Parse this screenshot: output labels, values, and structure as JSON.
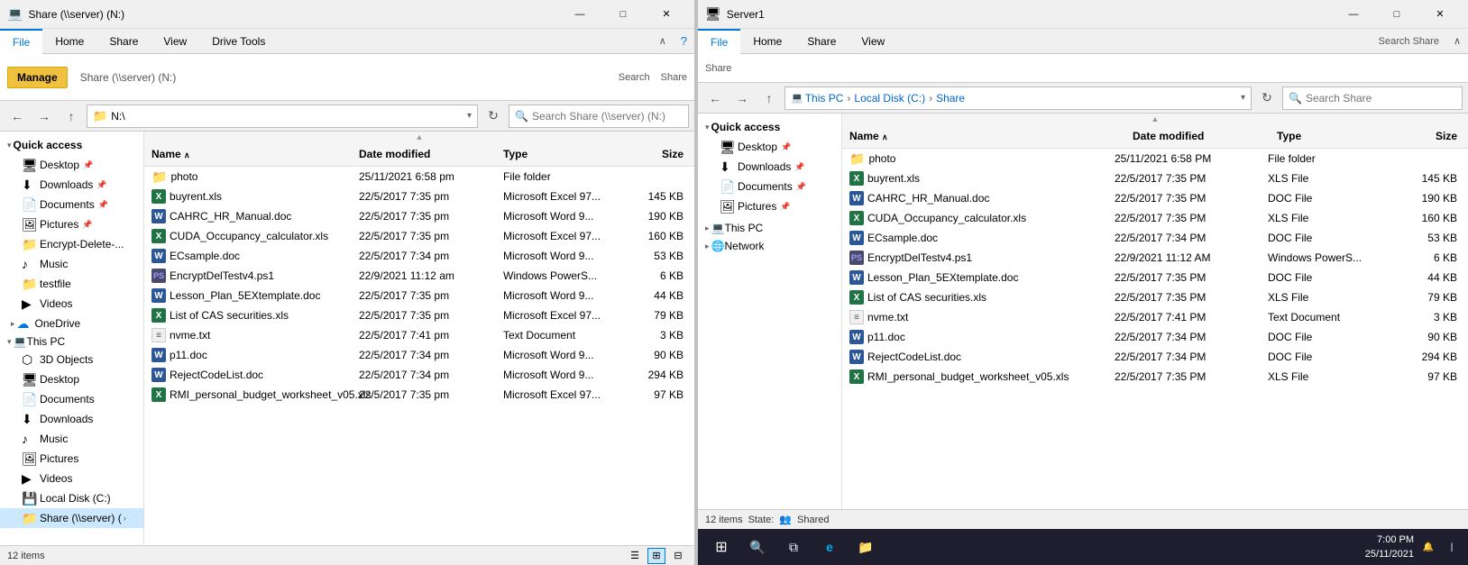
{
  "leftWindow": {
    "title": "Share (\\\\server) (N:)",
    "titlebarLabel": "Share (\\\\server) (N:)",
    "tabs": {
      "file": "File",
      "home": "Home",
      "share": "Share",
      "view": "View",
      "driveTools": "Drive Tools"
    },
    "manageBtn": "Manage",
    "ribbon": {
      "share_label": "Share (\\\\server) (N:)"
    },
    "addressBar": "N:\\",
    "searchPlaceholder": "Search Share (\\\\server) (N:)",
    "columns": {
      "name": "Name",
      "dateModified": "Date modified",
      "type": "Type",
      "size": "Size"
    },
    "files": [
      {
        "name": "photo",
        "date": "25/11/2021 6:58 pm",
        "type": "File folder",
        "size": "",
        "icon": "folder"
      },
      {
        "name": "buyrent.xls",
        "date": "22/5/2017 7:35 pm",
        "type": "Microsoft Excel 97...",
        "size": "145 KB",
        "icon": "excel"
      },
      {
        "name": "CAHRC_HR_Manual.doc",
        "date": "22/5/2017 7:35 pm",
        "type": "Microsoft Word 9...",
        "size": "190 KB",
        "icon": "word"
      },
      {
        "name": "CUDA_Occupancy_calculator.xls",
        "date": "22/5/2017 7:35 pm",
        "type": "Microsoft Excel 97...",
        "size": "160 KB",
        "icon": "excel"
      },
      {
        "name": "ECsample.doc",
        "date": "22/5/2017 7:34 pm",
        "type": "Microsoft Word 9...",
        "size": "53 KB",
        "icon": "word"
      },
      {
        "name": "EncryptDelTestv4.ps1",
        "date": "22/9/2021 11:12 am",
        "type": "Windows PowerS...",
        "size": "6 KB",
        "icon": "ps"
      },
      {
        "name": "Lesson_Plan_5EXtemplate.doc",
        "date": "22/5/2017 7:35 pm",
        "type": "Microsoft Word 9...",
        "size": "44 KB",
        "icon": "word"
      },
      {
        "name": "List of CAS securities.xls",
        "date": "22/5/2017 7:35 pm",
        "type": "Microsoft Excel 97...",
        "size": "79 KB",
        "icon": "excel"
      },
      {
        "name": "nvme.txt",
        "date": "22/5/2017 7:41 pm",
        "type": "Text Document",
        "size": "3 KB",
        "icon": "txt"
      },
      {
        "name": "p11.doc",
        "date": "22/5/2017 7:34 pm",
        "type": "Microsoft Word 9...",
        "size": "90 KB",
        "icon": "word"
      },
      {
        "name": "RejectCodeList.doc",
        "date": "22/5/2017 7:34 pm",
        "type": "Microsoft Word 9...",
        "size": "294 KB",
        "icon": "word"
      },
      {
        "name": "RMI_personal_budget_worksheet_v05.xls",
        "date": "22/5/2017 7:35 pm",
        "type": "Microsoft Excel 97...",
        "size": "97 KB",
        "icon": "excel"
      }
    ],
    "sidebar": {
      "quickAccess": "Quick access",
      "desktop": "Desktop",
      "downloads": "Downloads",
      "documents": "Documents",
      "pictures": "Pictures",
      "encryptDelete": "Encrypt-Delete-...",
      "music": "Music",
      "testfile": "testfile",
      "videos": "Videos",
      "oneDrive": "OneDrive",
      "thisPC": "This PC",
      "objects3d": "3D Objects",
      "desktop2": "Desktop",
      "documents2": "Documents",
      "downloads2": "Downloads",
      "music2": "Music",
      "pictures2": "Pictures",
      "videos2": "Videos",
      "localDisk": "Local Disk (C:)",
      "share": "Share (\\\\server) ("
    },
    "statusBar": {
      "itemCount": "12 items"
    }
  },
  "rightWindow": {
    "title": "Server1",
    "tabs": {
      "file": "File",
      "home": "Home",
      "share": "Share",
      "view": "View"
    },
    "breadcrumb": [
      "This PC",
      "Local Disk (C:)",
      "Share"
    ],
    "searchPlaceholder": "Search Share",
    "columns": {
      "name": "Name",
      "dateModified": "Date modified",
      "type": "Type",
      "size": "Size"
    },
    "sidebar": {
      "quickAccess": "Quick access",
      "desktop": "Desktop",
      "downloads": "Downloads",
      "documents": "Documents",
      "pictures": "Pictures",
      "thisPC": "This PC",
      "network": "Network"
    },
    "files": [
      {
        "name": "photo",
        "date": "25/11/2021 6:58 PM",
        "type": "File folder",
        "size": "",
        "icon": "folder"
      },
      {
        "name": "buyrent.xls",
        "date": "22/5/2017 7:35 PM",
        "type": "XLS File",
        "size": "145 KB",
        "icon": "excel"
      },
      {
        "name": "CAHRC_HR_Manual.doc",
        "date": "22/5/2017 7:35 PM",
        "type": "DOC File",
        "size": "190 KB",
        "icon": "word"
      },
      {
        "name": "CUDA_Occupancy_calculator.xls",
        "date": "22/5/2017 7:35 PM",
        "type": "XLS File",
        "size": "160 KB",
        "icon": "excel"
      },
      {
        "name": "ECsample.doc",
        "date": "22/5/2017 7:34 PM",
        "type": "DOC File",
        "size": "53 KB",
        "icon": "word"
      },
      {
        "name": "EncryptDelTestv4.ps1",
        "date": "22/9/2021 11:12 AM",
        "type": "Windows PowerS...",
        "size": "6 KB",
        "icon": "ps"
      },
      {
        "name": "Lesson_Plan_5EXtemplate.doc",
        "date": "22/5/2017 7:35 PM",
        "type": "DOC File",
        "size": "44 KB",
        "icon": "word"
      },
      {
        "name": "List of CAS securities.xls",
        "date": "22/5/2017 7:35 PM",
        "type": "XLS File",
        "size": "79 KB",
        "icon": "excel"
      },
      {
        "name": "nvme.txt",
        "date": "22/5/2017 7:41 PM",
        "type": "Text Document",
        "size": "3 KB",
        "icon": "txt"
      },
      {
        "name": "p11.doc",
        "date": "22/5/2017 7:34 PM",
        "type": "DOC File",
        "size": "90 KB",
        "icon": "word"
      },
      {
        "name": "RejectCodeList.doc",
        "date": "22/5/2017 7:34 PM",
        "type": "DOC File",
        "size": "294 KB",
        "icon": "word"
      },
      {
        "name": "RMI_personal_budget_worksheet_v05.xls",
        "date": "22/5/2017 7:35 PM",
        "type": "XLS File",
        "size": "97 KB",
        "icon": "excel"
      }
    ],
    "statusBar": {
      "itemCount": "12 items",
      "state": "State:",
      "shared": "Shared"
    },
    "taskbar": {
      "time": "7:00 PM",
      "date": "25/11/2021"
    }
  },
  "icons": {
    "folder": "📁",
    "excel": "X",
    "word": "W",
    "ps": "PS",
    "txt": "≡",
    "back": "←",
    "forward": "→",
    "up": "↑",
    "search": "🔍",
    "refresh": "↻",
    "close": "✕",
    "maximize": "□",
    "minimize": "—",
    "chevronRight": "›",
    "chevronDown": "∨",
    "pin": "📌",
    "pc": "💻",
    "desktop": "🖥",
    "downloads": "⬇",
    "documents": "📄",
    "pictures": "🖼",
    "music": "♪",
    "videos": "▶",
    "onedrive": "☁",
    "network": "🌐",
    "localDisk": "💾",
    "share": "📂",
    "windows": "⊞",
    "search_tb": "🔍",
    "taskview": "⧉",
    "edge": "e",
    "fileexp": "📁"
  }
}
